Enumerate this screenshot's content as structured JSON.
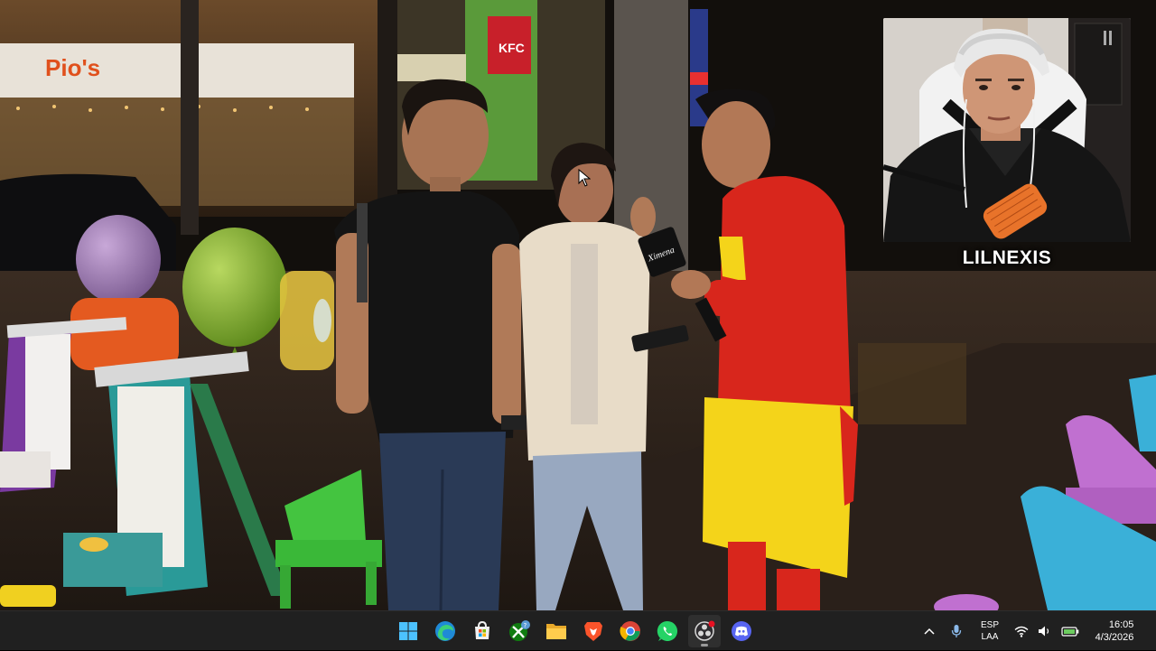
{
  "video": {
    "signs": {
      "restaurant": "Pio's",
      "fast_food": "KFC"
    },
    "mic_flag": "Ximena"
  },
  "webcam": {
    "streamer_name": "LILNEXIS"
  },
  "taskbar": {
    "apps": [
      {
        "icon": "windows-start-icon"
      },
      {
        "icon": "edge-browser-icon"
      },
      {
        "icon": "microsoft-store-icon"
      },
      {
        "icon": "xbox-icon"
      },
      {
        "icon": "file-explorer-icon"
      },
      {
        "icon": "brave-browser-icon"
      },
      {
        "icon": "chrome-icon"
      },
      {
        "icon": "whatsapp-icon"
      },
      {
        "icon": "obs-recording-icon",
        "active": true
      },
      {
        "icon": "discord-icon"
      }
    ],
    "tray": {
      "language_line1": "ESP",
      "language_line2": "LAA",
      "time": "16:05",
      "date": "4/3/2026"
    }
  },
  "colors": {
    "taskbar_bg": "#202020",
    "costume_red": "#d8261c",
    "costume_yellow": "#f4d41a"
  }
}
